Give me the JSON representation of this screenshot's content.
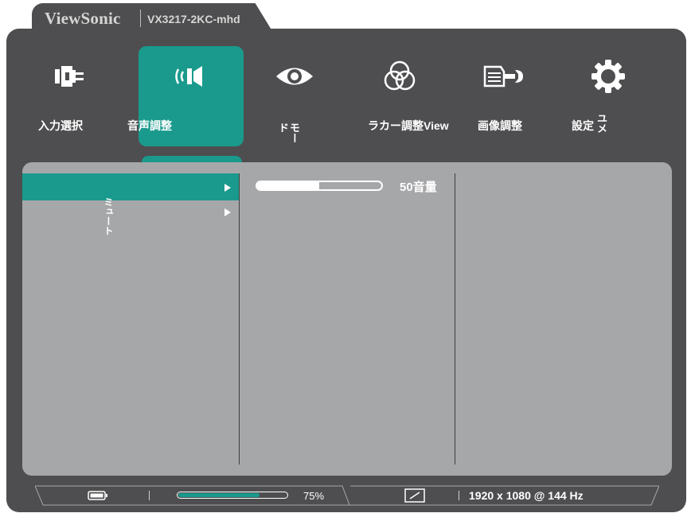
{
  "header": {
    "brand": "ViewSonic",
    "model": "VX3217-2KC-mhd"
  },
  "menu": {
    "items": [
      {
        "label": "入力選択",
        "icon": "input-plug-icon"
      },
      {
        "label": "音声調整",
        "icon": "speaker-icon"
      },
      {
        "label": "モード",
        "icon": "eye-icon"
      },
      {
        "label": "ラカー調整View",
        "icon": "color-circles-icon"
      },
      {
        "label": "画像調整",
        "icon": "hand-wrench-icon"
      },
      {
        "label": "設定",
        "label_vertical": "ユメ",
        "icon": "gear-icon"
      }
    ],
    "active_index": 1
  },
  "submenu": {
    "items": [
      {
        "label": "",
        "active": true
      },
      {
        "label": "ミュート",
        "active": false
      }
    ]
  },
  "volume": {
    "label": "50音量",
    "value": 50,
    "max": 100
  },
  "status": {
    "percent": 75,
    "percent_label": "75%",
    "resolution": "1920 x 1080 @ 144 Hz"
  },
  "colors": {
    "frame": "#4e4e50",
    "accent": "#1a9a8c",
    "panel": "#a6a7a9"
  }
}
